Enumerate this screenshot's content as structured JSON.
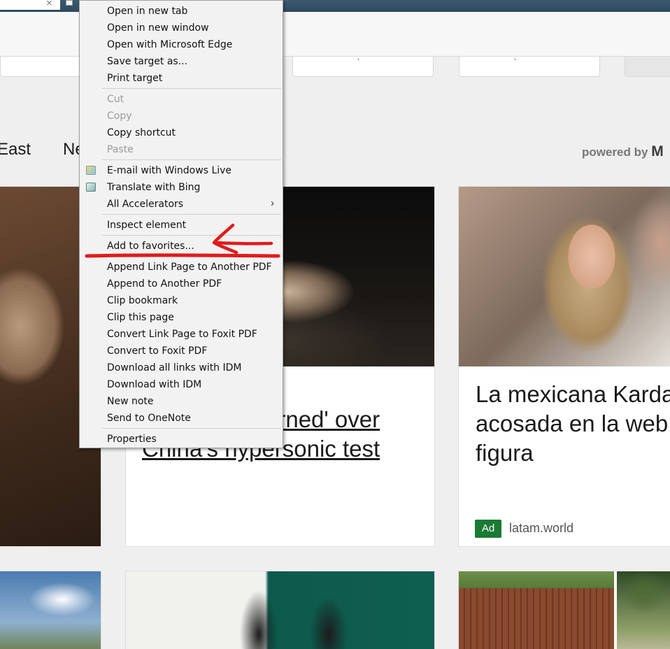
{
  "context_menu": {
    "items": [
      {
        "label": "Open in new tab",
        "disabled": false
      },
      {
        "label": "Open in new window",
        "disabled": false
      },
      {
        "label": "Open with Microsoft Edge",
        "disabled": false
      },
      {
        "label": "Save target as...",
        "disabled": false
      },
      {
        "label": "Print target",
        "disabled": false
      },
      {
        "label": "Cut",
        "disabled": true
      },
      {
        "label": "Copy",
        "disabled": true
      },
      {
        "label": "Copy shortcut",
        "disabled": false
      },
      {
        "label": "Paste",
        "disabled": true
      },
      {
        "label": "E-mail with Windows Live",
        "disabled": false,
        "icon": "windows-live-mail-icon"
      },
      {
        "label": "Translate with Bing",
        "disabled": false,
        "icon": "bing-translate-icon"
      },
      {
        "label": "All Accelerators",
        "disabled": false,
        "submenu": "›"
      },
      {
        "label": "Inspect element",
        "disabled": false
      },
      {
        "label": "Add to favorites...",
        "disabled": false
      },
      {
        "label": "Append Link Page to Another PDF",
        "disabled": false
      },
      {
        "label": "Append to Another PDF",
        "disabled": false
      },
      {
        "label": "Clip bookmark",
        "disabled": false
      },
      {
        "label": "Clip this page",
        "disabled": false
      },
      {
        "label": "Convert Link Page to Foxit PDF",
        "disabled": false
      },
      {
        "label": "Convert to Foxit PDF",
        "disabled": false
      },
      {
        "label": "Download all links with IDM",
        "disabled": false
      },
      {
        "label": "Download with IDM",
        "disabled": false
      },
      {
        "label": "New note",
        "disabled": false
      },
      {
        "label": "Send to OneNote",
        "disabled": false
      },
      {
        "label": "Properties",
        "disabled": false
      }
    ]
  },
  "nav": {
    "east": "East",
    "partial": "Ne",
    "powered_prefix": "powered by",
    "powered_brand": "M"
  },
  "cards": {
    "middle_headline_line1": "erned' over",
    "middle_headline_line2": "China's hypersonic test",
    "right_headline": [
      "La mexicana Karda",
      "acosada en la web",
      "figura"
    ],
    "ad_badge": "Ad",
    "ad_source": "latam.world"
  },
  "colors": {
    "annotation": "#e01b1b",
    "ad_badge": "#1b7a34",
    "tabstrip": "#2e4a5f"
  }
}
